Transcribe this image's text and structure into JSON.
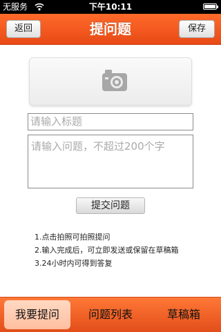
{
  "status_bar": {
    "carrier": "无服务",
    "time": "下午10:11"
  },
  "nav": {
    "title": "提问题",
    "back_label": "返回",
    "save_label": "保存"
  },
  "form": {
    "title_placeholder": "请输入标题",
    "question_placeholder": "请输入问题，不超过200个字",
    "submit_label": "提交问题"
  },
  "instructions": [
    "1.点击拍照可拍照提问",
    "2.输入完成后，可立即发送或保留在草稿箱",
    "3.24小时内可得到答复"
  ],
  "tabs": [
    {
      "label": "我要提问",
      "selected": true
    },
    {
      "label": "问题列表",
      "selected": false
    },
    {
      "label": "草稿箱",
      "selected": false
    }
  ],
  "colors": {
    "accent": "#ee5a1e",
    "tab_selected": "#ffc9ad"
  },
  "icons": {
    "photo": "camera-icon",
    "signal": "wifi-icon",
    "power": "battery-icon"
  }
}
